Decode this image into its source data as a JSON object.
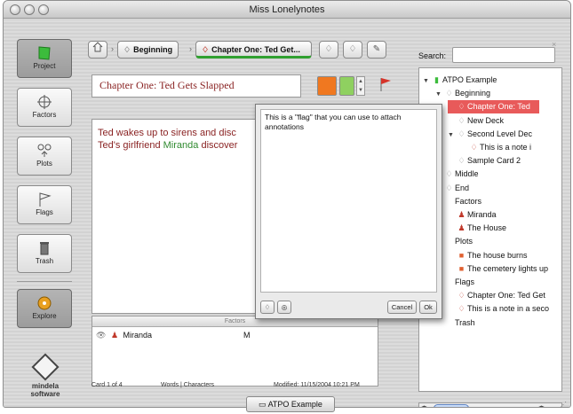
{
  "window": {
    "title": "Miss Lonelynotes"
  },
  "sidebar": {
    "items": [
      {
        "label": "Project",
        "icon": "project-icon",
        "active": true
      },
      {
        "label": "Factors",
        "icon": "factors-icon",
        "active": false
      },
      {
        "label": "Plots",
        "icon": "plots-icon",
        "active": false
      },
      {
        "label": "Flags",
        "icon": "flags-icon",
        "active": false
      },
      {
        "label": "Trash",
        "icon": "trash-icon",
        "active": false
      },
      {
        "label": "Explore",
        "icon": "explore-icon",
        "active": true
      }
    ],
    "logo_line1": "mindela",
    "logo_line2": "software"
  },
  "breadcrumb": {
    "items": [
      {
        "label": "Beginning"
      },
      {
        "label": "Chapter One: Ted Get..."
      }
    ]
  },
  "card": {
    "title": "Chapter One: Ted Gets Slapped",
    "colors": {
      "orange": "#f07820",
      "green": "#8fd060"
    },
    "text_line1": "Ted wakes up to sirens and disc",
    "text_line2_prefix": "Ted's girlfriend ",
    "text_line2_name": "Miranda",
    "text_line2_suffix": " discover"
  },
  "factors_panel": {
    "header": "Factors",
    "row_label": "Miranda",
    "row_extra": "M"
  },
  "status": {
    "card": "Card 1 of 4",
    "words": "Words | Characters",
    "modified": "Modified: 11/15/2004 10:21 PM"
  },
  "popup": {
    "text": "This is a \"flag\" that you can use to attach annotations",
    "cancel": "Cancel",
    "ok": "Ok"
  },
  "search": {
    "label": "Search:",
    "value": ""
  },
  "tree": {
    "nodes": [
      {
        "label": "ATPO Example",
        "level": 0,
        "twisty": "▼",
        "icon": "book-icon",
        "selected": false
      },
      {
        "label": "Beginning",
        "level": 1,
        "twisty": "▼",
        "icon": "card-icon",
        "selected": false
      },
      {
        "label": "Chapter One: Ted",
        "level": 2,
        "twisty": "",
        "icon": "flag-card-icon",
        "selected": true
      },
      {
        "label": "New Deck",
        "level": 2,
        "twisty": "",
        "icon": "card-icon",
        "selected": false
      },
      {
        "label": "Second Level Dec",
        "level": 2,
        "twisty": "▼",
        "icon": "card-icon",
        "selected": false
      },
      {
        "label": "This is a note i",
        "level": 3,
        "twisty": "",
        "icon": "flag-card-icon",
        "selected": false
      },
      {
        "label": "Sample Card 2",
        "level": 2,
        "twisty": "",
        "icon": "card-icon",
        "selected": false
      },
      {
        "label": "Middle",
        "level": 1,
        "twisty": "",
        "icon": "card-icon",
        "selected": false
      },
      {
        "label": "End",
        "level": 1,
        "twisty": "",
        "icon": "card-icon",
        "selected": false
      },
      {
        "label": "Factors",
        "level": 1,
        "twisty": "",
        "icon": "",
        "selected": false
      },
      {
        "label": "Miranda",
        "level": 2,
        "twisty": "",
        "icon": "person-icon",
        "selected": false
      },
      {
        "label": "The House",
        "level": 2,
        "twisty": "",
        "icon": "person-icon",
        "selected": false
      },
      {
        "label": "Plots",
        "level": 1,
        "twisty": "",
        "icon": "",
        "selected": false
      },
      {
        "label": "The house burns",
        "level": 2,
        "twisty": "",
        "icon": "plot-icon",
        "selected": false
      },
      {
        "label": "The cemetery lights up",
        "level": 2,
        "twisty": "",
        "icon": "plot-icon",
        "selected": false
      },
      {
        "label": "Flags",
        "level": 1,
        "twisty": "",
        "icon": "",
        "selected": false
      },
      {
        "label": "Chapter One: Ted Get",
        "level": 2,
        "twisty": "",
        "icon": "flag-card-icon",
        "selected": false
      },
      {
        "label": "This is a note in a seco",
        "level": 2,
        "twisty": "",
        "icon": "flag-card-icon",
        "selected": false
      },
      {
        "label": "Trash",
        "level": 1,
        "twisty": "",
        "icon": "",
        "selected": false
      }
    ]
  },
  "bottom_tab": {
    "label": "ATPO Example"
  }
}
